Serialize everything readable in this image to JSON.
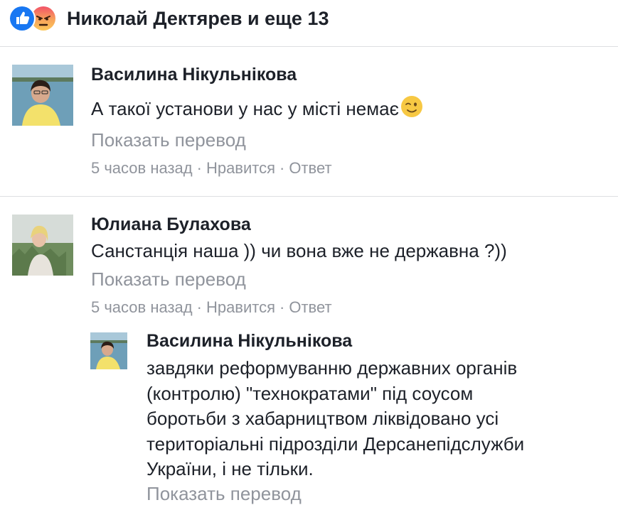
{
  "reactions": {
    "icons": [
      "like-icon",
      "angry-icon"
    ],
    "summary": "Николай Дектярев и еще 13"
  },
  "comments": [
    {
      "author": "Василина Нікульнікова",
      "text": "А такої установи у нас у місті немає",
      "emoji": "wink-emoji",
      "translate": "Показать перевод",
      "time": "5 часов назад",
      "like": "Нравится",
      "reply": "Ответ"
    },
    {
      "author": "Юлиана Булахова",
      "text": "Санстанція наша )) чи вона вже не державна ?))",
      "translate": "Показать перевод",
      "time": "5 часов назад",
      "like": "Нравится",
      "reply": "Ответ"
    }
  ],
  "reply": {
    "author": "Василина Нікульнікова",
    "lines": [
      "завдяки реформуванню державних органів",
      "(контролю) \"технократами\" під соусом",
      "боротьби з хабарництвом ліквідовано усі",
      "територіальні підрозділи Дерсанепідслужби",
      "України, і не тільки."
    ],
    "translate": "Показать перевод"
  },
  "colors": {
    "text": "#1d2129",
    "muted": "#90949c",
    "divider": "#dddfe2",
    "like_blue": "#1877f2"
  }
}
